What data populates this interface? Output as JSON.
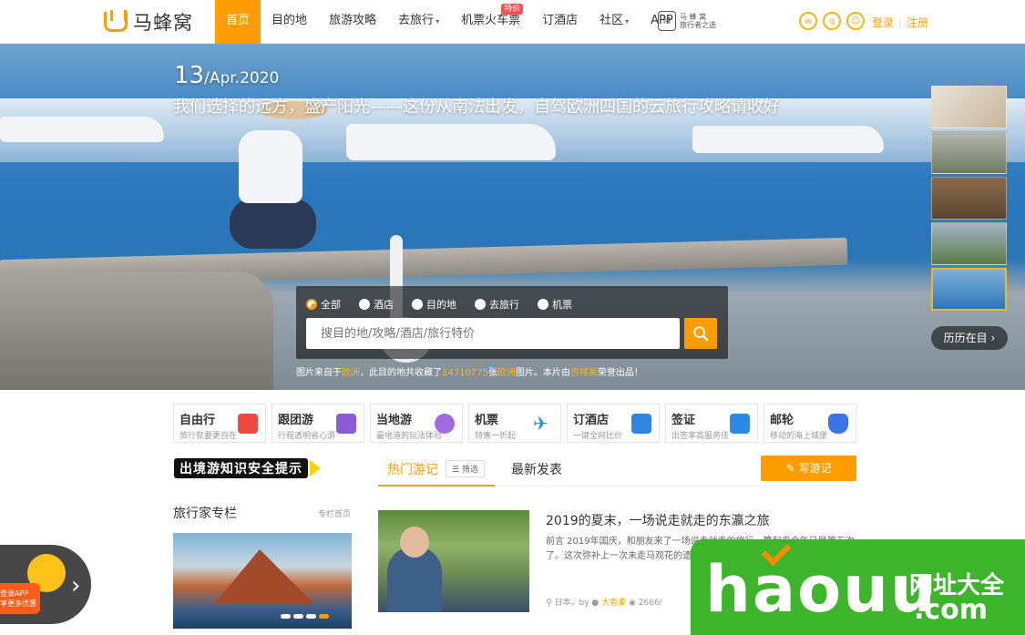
{
  "logo": {
    "text": "马蜂窝"
  },
  "nav": {
    "items": [
      {
        "label": "首页"
      },
      {
        "label": "目的地"
      },
      {
        "label": "旅游攻略"
      },
      {
        "label": "去旅行"
      },
      {
        "label": "机票火车票"
      },
      {
        "label": "订酒店"
      },
      {
        "label": "社区"
      },
      {
        "label": "APP"
      }
    ],
    "badge": "特价",
    "slogan": {
      "line1": "马 蜂 窝",
      "line2": "旅行者之选"
    }
  },
  "auth": {
    "login": "登录",
    "register": "注册"
  },
  "hero": {
    "day": "13",
    "month": "/Apr.2020",
    "title": "我们选择的远方，盛产阳光——这份从南法出发，自驾欧洲四国的云旅行攻略请收好",
    "history_button": "历历在目",
    "credit": {
      "p1": "图片来自于",
      "place": "欧洲",
      "p2": "，此目的地共收藏了",
      "count": "14710775",
      "p3": "张",
      "place2": "欧洲",
      "p4": "图片。本片由",
      "author": "吉祥美",
      "p5": "荣誉出品！"
    }
  },
  "search": {
    "options": [
      "全部",
      "酒店",
      "目的地",
      "去旅行",
      "机票"
    ],
    "placeholder": "搜目的地/攻略/酒店/旅行特价"
  },
  "services": [
    {
      "name": "自由行",
      "desc": "旅行就要更自在",
      "color": "#f0483e"
    },
    {
      "name": "跟团游",
      "desc": "行程透明省心游",
      "color": "#8a5bd6"
    },
    {
      "name": "当地游",
      "desc": "最地道的玩法体验",
      "color": "#a06be0"
    },
    {
      "name": "机票",
      "desc": "特惠一折起",
      "color": "#1f8fe8"
    },
    {
      "name": "订酒店",
      "desc": "一键全网比价",
      "color": "#2f86e0"
    },
    {
      "name": "签证",
      "desc": "出签率高服务佳",
      "color": "#2a8ae6"
    },
    {
      "name": "邮轮",
      "desc": "移动的海上城堡",
      "color": "#3a74e8"
    }
  ],
  "warning_banner": "出境游知识安全提示",
  "column": {
    "title": "旅行家专栏",
    "link": "专栏首页"
  },
  "tabs": {
    "hot": "热门游记",
    "filter": "筛选",
    "new": "最新发表",
    "write": "写游记"
  },
  "article": {
    "title": "2019的夏末，一场说走就走的东瀛之旅",
    "body": "前言 2019年国庆，和朋友来了一场说走就走的旅行，算起来今年已是第五次了。这次弥补上一次未走马观花的遗憾。一",
    "place": "日本",
    "by": "by",
    "author": "大香柔",
    "views": "2666/"
  },
  "app_promo": {
    "line1": "登录APP",
    "line2": "享更多优惠"
  },
  "watermark": {
    "big": "haouu",
    "cn": "网址大全",
    "com": ".com"
  },
  "colors": {
    "accent": "#ff9d00",
    "watermark_green": "#3cb52a"
  },
  "icons": {
    "social": [
      "weibo-icon",
      "qq-icon",
      "wechat-icon"
    ],
    "search": "search-icon",
    "edit": "edit-icon",
    "location": "location-pin-icon",
    "view": "eye-icon"
  }
}
